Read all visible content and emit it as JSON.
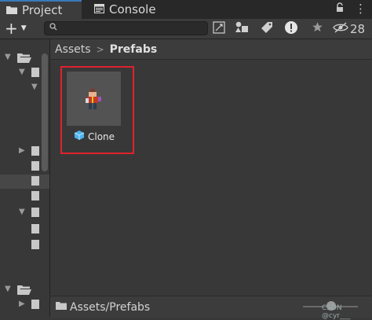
{
  "tabs": [
    {
      "label": "Project",
      "icon": "folder-icon"
    },
    {
      "label": "Console",
      "icon": "console-icon"
    }
  ],
  "toolbar": {
    "add_label": "+",
    "search_placeholder": "",
    "hidden_count": "28"
  },
  "breadcrumb": {
    "root": "Assets",
    "current": "Prefabs"
  },
  "asset": {
    "name": "Clone",
    "icon": "prefab-cube-icon"
  },
  "status": {
    "path": "Assets/Prefabs"
  },
  "watermark": "CSDN @cyr___",
  "colors": {
    "highlight": "#e0222b",
    "active_tab_accent": "#3a79bb",
    "prefab_cube": "#4fb3f0"
  }
}
